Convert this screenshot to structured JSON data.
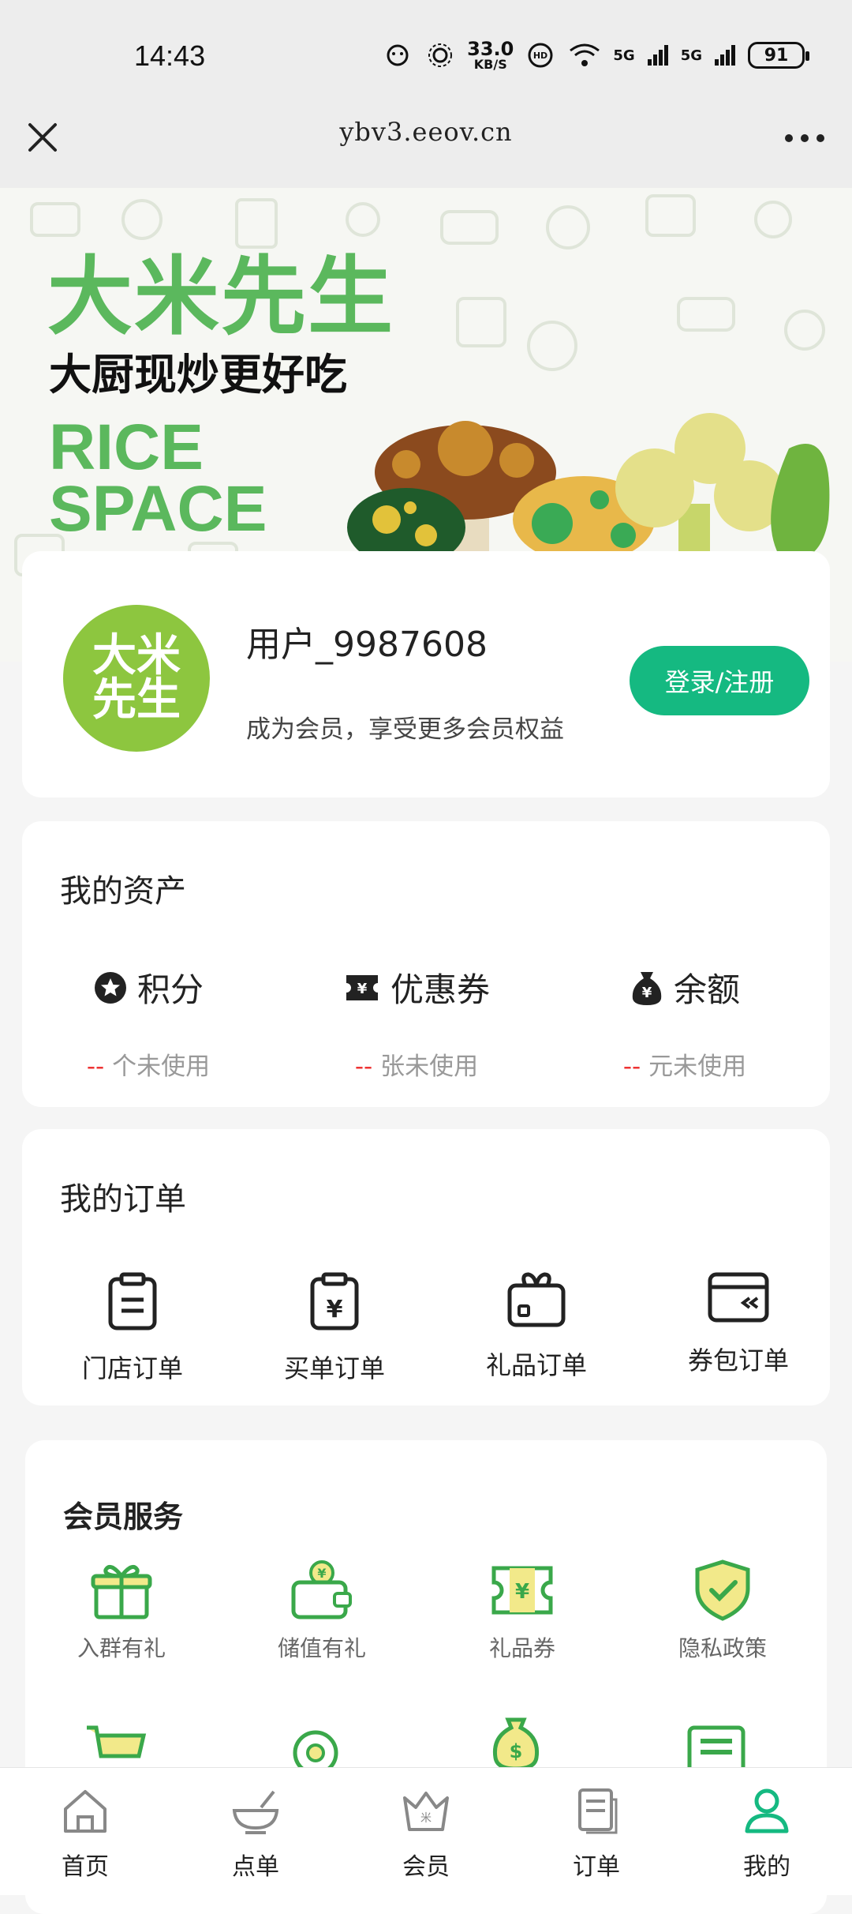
{
  "status_bar": {
    "time": "14:43",
    "speed_value": "33.0",
    "speed_unit": "KB/S",
    "net1": "5G",
    "net2": "5G",
    "battery": "91"
  },
  "nav": {
    "url": "ybv3.eeov.cn"
  },
  "banner": {
    "title": "大米先生",
    "slogan": "大厨现炒更好吃",
    "en_line1": "RICE",
    "en_line2": "SPACE"
  },
  "user": {
    "avatar_line1": "大米",
    "avatar_line2": "先生",
    "name": "用户_9987608",
    "tagline": "成为会员，享受更多会员权益",
    "login_label": "登录/注册"
  },
  "assets": {
    "title": "我的资产",
    "items": [
      {
        "label": "积分",
        "value": "--",
        "suffix": "个未使用",
        "icon": "star-badge-icon"
      },
      {
        "label": "优惠券",
        "value": "--",
        "suffix": "张未使用",
        "icon": "ticket-icon"
      },
      {
        "label": "余额",
        "value": "--",
        "suffix": "元未使用",
        "icon": "money-bag-icon"
      }
    ]
  },
  "orders": {
    "title": "我的订单",
    "items": [
      {
        "label": "门店订单",
        "icon": "clipboard-icon"
      },
      {
        "label": "买单订单",
        "icon": "clipboard-yen-icon"
      },
      {
        "label": "礼品订单",
        "icon": "gift-box-icon"
      },
      {
        "label": "券包订单",
        "icon": "card-wallet-icon"
      }
    ]
  },
  "services": {
    "title": "会员服务",
    "items": [
      {
        "label": "入群有礼",
        "icon": "gift-icon"
      },
      {
        "label": "储值有礼",
        "icon": "wallet-coin-icon"
      },
      {
        "label": "礼品券",
        "icon": "voucher-icon"
      },
      {
        "label": "隐私政策",
        "icon": "shield-check-icon"
      }
    ]
  },
  "tabbar": {
    "items": [
      {
        "label": "首页",
        "icon": "home-icon"
      },
      {
        "label": "点单",
        "icon": "bowl-icon"
      },
      {
        "label": "会员",
        "icon": "crown-icon"
      },
      {
        "label": "订单",
        "icon": "document-icon"
      },
      {
        "label": "我的",
        "icon": "person-icon"
      }
    ],
    "active_color": "#15b981"
  },
  "colors": {
    "brand_green": "#5bb85d",
    "button_green": "#15b981",
    "avatar_green": "#8dc63f",
    "dash_red": "#e33333"
  }
}
